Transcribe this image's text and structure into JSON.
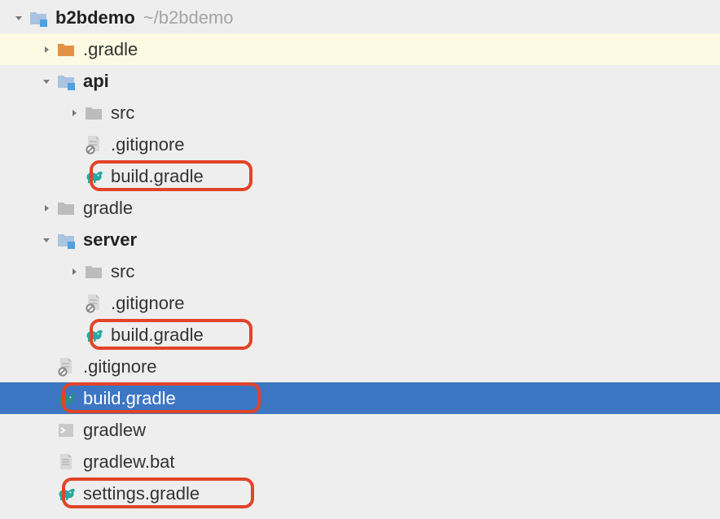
{
  "project": {
    "name": "b2bdemo",
    "path": "~/b2bdemo"
  },
  "tree": {
    "gradle_dir": ".gradle",
    "api": {
      "name": "api",
      "src": "src",
      "gitignore": ".gitignore",
      "build": "build.gradle"
    },
    "gradle_module": "gradle",
    "server": {
      "name": "server",
      "src": "src",
      "gitignore": ".gitignore",
      "build": "build.gradle"
    },
    "root": {
      "gitignore": ".gitignore",
      "build": "build.gradle",
      "gradlew": "gradlew",
      "gradlew_bat": "gradlew.bat",
      "settings": "settings.gradle"
    }
  }
}
